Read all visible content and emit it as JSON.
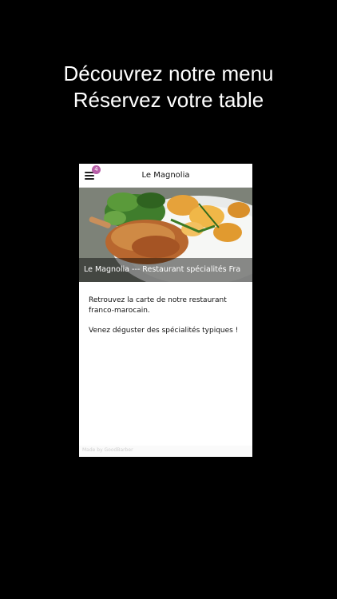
{
  "promo": {
    "line1": "Découvrez notre menu",
    "line2": "Réservez votre table"
  },
  "appbar": {
    "title": "Le Magnolia",
    "menu_icon": "hamburger-menu-icon",
    "badge": "4",
    "badge_color": "#b85fa8"
  },
  "hero": {
    "image": "roast-duck-leg-with-salad-and-chips-photo",
    "caption": "Le Magnolia --- Restaurant spécialités Fra"
  },
  "content": {
    "paragraph1": "Retrouvez la carte de notre restaurant franco-marocain.",
    "paragraph2": "Venez déguster des spécialités typiques !"
  },
  "footer": {
    "text": "Made by GoodBarber"
  }
}
